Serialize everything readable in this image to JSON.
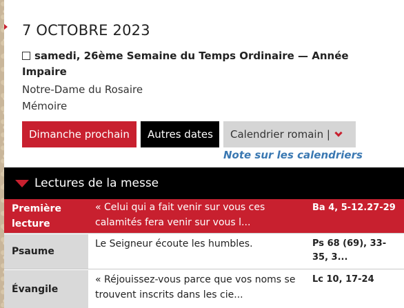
{
  "header": {
    "date_title": "7 OCTOBRE 2023",
    "day_description": "samedi, 26ème Semaine du Temps Ordinaire — Année Impaire",
    "feast_name": "Notre-Dame du Rosaire",
    "feast_rank": "Mémoire"
  },
  "buttons": {
    "next_sunday": "Dimanche prochain",
    "other_dates": "Autres dates",
    "calendar": "Calendrier romain |"
  },
  "note_link": "Note sur les calendriers",
  "readings": {
    "section_title": "Lectures de la messe",
    "rows": [
      {
        "label": "Première lecture",
        "text": "« Celui qui a fait venir sur vous ces calamités fera venir sur vous l...",
        "ref": "Ba 4, 5-12.27-29"
      },
      {
        "label": "Psaume",
        "text": "Le Seigneur écoute les humbles.",
        "ref": "Ps 68 (69), 33-35, 3..."
      },
      {
        "label": "Évangile",
        "text": "« Réjouissez-vous parce que vos noms se trouvent inscrits dans les cie...",
        "ref": "Lc 10, 17-24"
      }
    ]
  },
  "colors": {
    "accent_red": "#c8202f",
    "link_blue": "#3a78b2",
    "header_black": "#000000"
  }
}
